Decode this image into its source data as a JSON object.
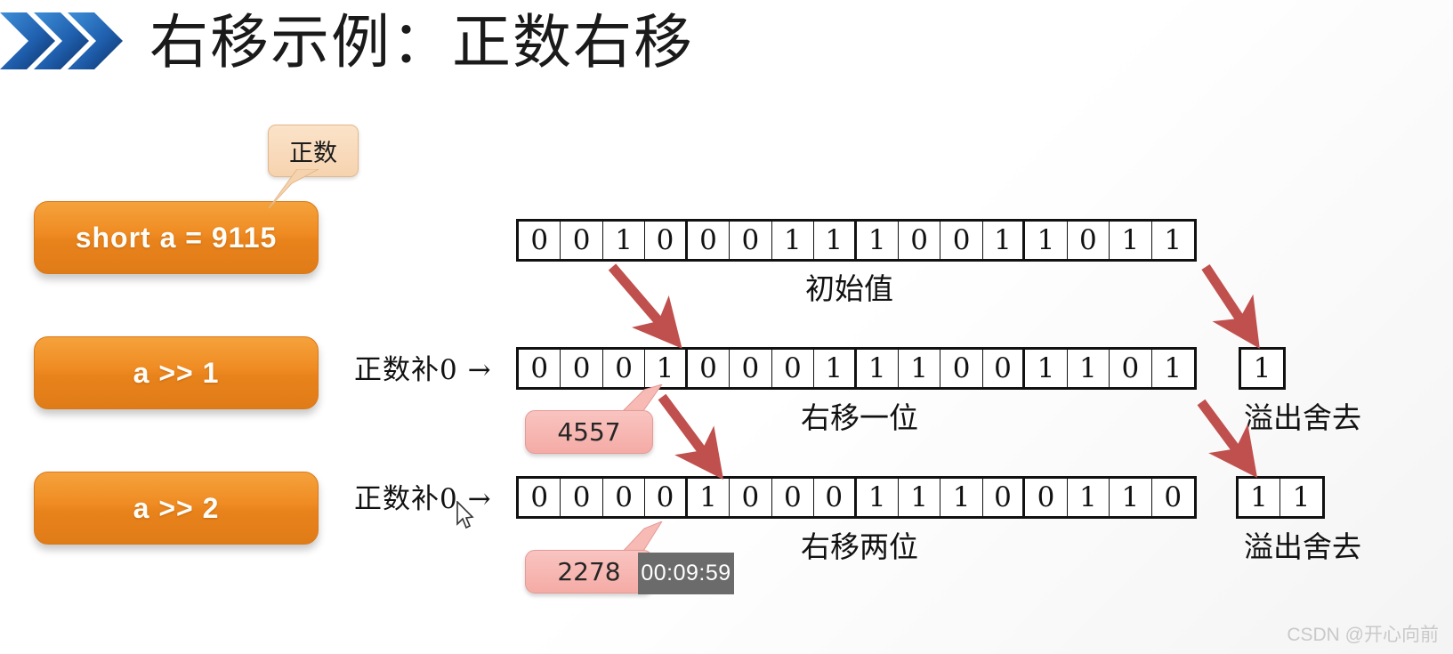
{
  "header": {
    "title": "右移示例：正数右移",
    "logo_icon": "double-chevron-icon",
    "logo_color": "#1f5fae"
  },
  "theme": {
    "pill_color": "#ef8b22",
    "callout_peach": "#f6d3af",
    "callout_pink": "#f5aba6",
    "arrow_red": "#c0504d",
    "bit_border": "#111111"
  },
  "pills": [
    {
      "label": "short a = 9115"
    },
    {
      "label": "a >> 1"
    },
    {
      "label": "a >> 2"
    }
  ],
  "callouts": {
    "positive": {
      "label": "正数"
    },
    "value_shift1": {
      "label": "4557"
    },
    "value_shift2": {
      "label": "2278"
    }
  },
  "pad_labels": [
    {
      "text": "正数补0 →"
    },
    {
      "text": "正数补0 →"
    }
  ],
  "rows": [
    {
      "name": "initial",
      "bits": [
        "0",
        "0",
        "1",
        "0",
        "0",
        "0",
        "1",
        "1",
        "1",
        "0",
        "0",
        "1",
        "1",
        "0",
        "1",
        "1"
      ],
      "caption": "初始值",
      "overflow": null,
      "overflow_caption": null
    },
    {
      "name": "shift-right-1",
      "bits": [
        "0",
        "0",
        "0",
        "1",
        "0",
        "0",
        "0",
        "1",
        "1",
        "1",
        "0",
        "0",
        "1",
        "1",
        "0",
        "1"
      ],
      "caption": "右移一位",
      "overflow": [
        "1"
      ],
      "overflow_caption": "溢出舍去"
    },
    {
      "name": "shift-right-2",
      "bits": [
        "0",
        "0",
        "0",
        "0",
        "1",
        "0",
        "0",
        "0",
        "1",
        "1",
        "1",
        "0",
        "0",
        "1",
        "1",
        "0"
      ],
      "caption": "右移两位",
      "overflow": [
        "1",
        "1"
      ],
      "overflow_caption": "溢出舍去"
    }
  ],
  "video": {
    "time_tooltip": "00:09:59"
  },
  "watermark": {
    "text": "CSDN @开心向前"
  }
}
